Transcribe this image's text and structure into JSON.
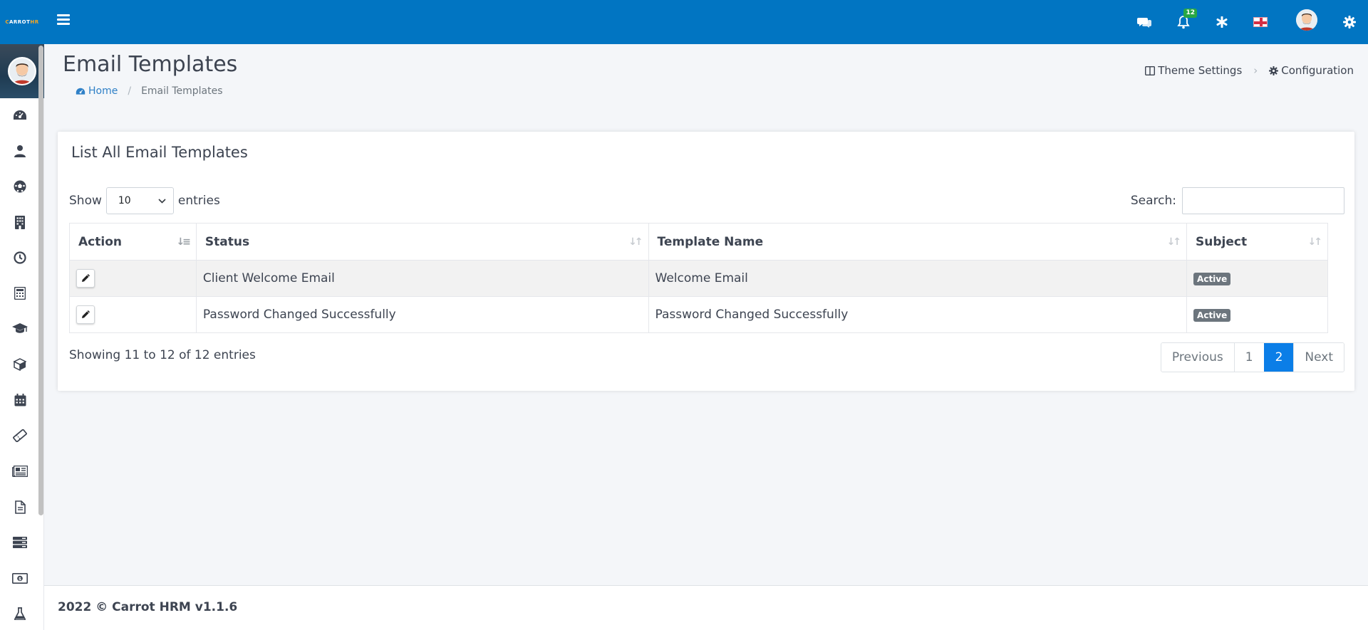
{
  "topbar": {
    "brand_prefix": "C",
    "brand_main": "ARROT",
    "brand_suffix": "HR",
    "notification_count": "12",
    "icons": [
      "menu-icon",
      "chat-icon",
      "bell-icon",
      "asterisk-icon",
      "flag-icon",
      "avatar",
      "gear-icon"
    ],
    "color": "#0175c2"
  },
  "sidebar": {
    "items": [
      "dashboard-icon",
      "user-icon",
      "soccer-ball-icon",
      "building-icon",
      "clock-icon",
      "calculator-icon",
      "graduation-cap-icon",
      "box-icon",
      "calendar-icon",
      "ticket-icon",
      "newspaper-icon",
      "document-icon",
      "server-icon",
      "money-icon",
      "flask-icon"
    ]
  },
  "header": {
    "title": "Email Templates",
    "breadcrumb": {
      "home": "Home",
      "current": "Email Templates"
    },
    "links": {
      "theme_settings": "Theme Settings",
      "configuration": "Configuration"
    }
  },
  "card": {
    "title": "List All Email Templates",
    "show_label": "Show",
    "page_size": "10",
    "entries_label": "entries",
    "search_label": "Search:",
    "search_value": ""
  },
  "table": {
    "columns": [
      "Action",
      "Status",
      "Template Name",
      "Subject"
    ],
    "rows": [
      {
        "status": "Client Welcome Email",
        "template_name": "Welcome Email",
        "subject": "Active"
      },
      {
        "status": "Password Changed Successfully",
        "template_name": "Password Changed Successfully",
        "subject": "Active"
      }
    ]
  },
  "pagination": {
    "info": "Showing 11 to 12 of 12 entries",
    "previous": "Previous",
    "pages": [
      "1",
      "2"
    ],
    "current_page": "2",
    "next": "Next"
  },
  "footer": {
    "text": "2022 © Carrot HRM v1.1.6"
  }
}
